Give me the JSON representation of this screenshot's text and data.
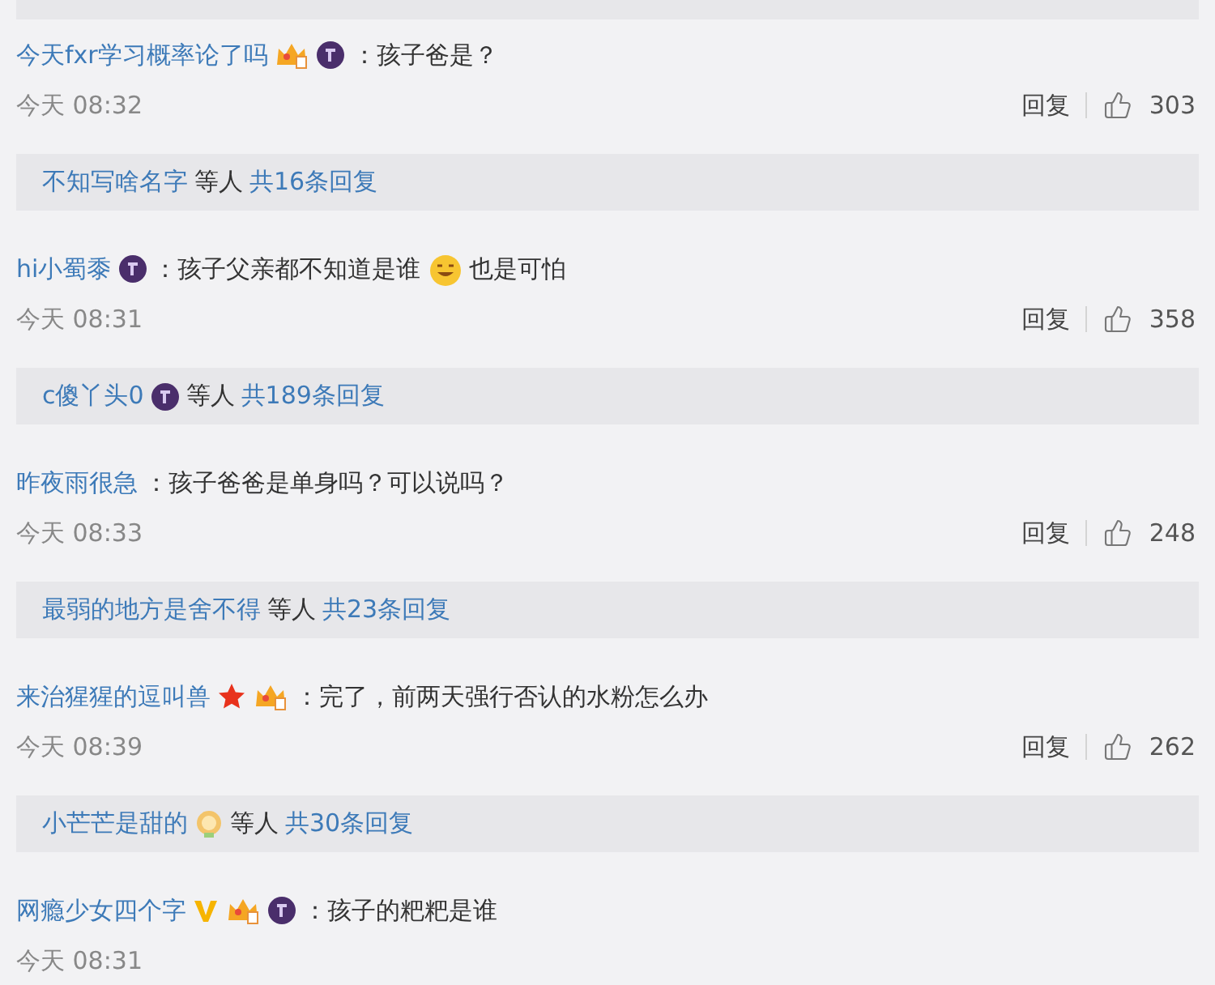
{
  "comments": [
    {
      "user": "今天fxr学习概率论了吗",
      "badges": [
        {
          "kind": "crown"
        },
        {
          "kind": "night"
        }
      ],
      "content": [
        {
          "kind": "text",
          "text": "：孩子爸是？"
        }
      ],
      "time": "今天 08:32",
      "actions": {
        "reply": "回复",
        "likes": "303"
      },
      "replies": {
        "user": "不知写啥名字",
        "others": "等人",
        "count": "共16条回复"
      }
    },
    {
      "user": "hi小蜀黍",
      "badges": [
        {
          "kind": "night"
        }
      ],
      "content": [
        {
          "kind": "text",
          "text": "：孩子父亲都不知道是谁"
        },
        {
          "kind": "emoji"
        },
        {
          "kind": "text",
          "text": "也是可怕"
        }
      ],
      "time": "今天 08:31",
      "actions": {
        "reply": "回复",
        "likes": "358"
      },
      "replies": {
        "user": "c傻丫头0",
        "badges": [
          {
            "kind": "night"
          }
        ],
        "others": "等人",
        "count": "共189条回复"
      }
    },
    {
      "user": "昨夜雨很急",
      "content": [
        {
          "kind": "text",
          "text": "：孩子爸爸是单身吗？可以说吗？"
        }
      ],
      "time": "今天 08:33",
      "actions": {
        "reply": "回复",
        "likes": "248"
      },
      "replies": {
        "user": "最弱的地方是舍不得",
        "others": "等人",
        "count": "共23条回复"
      }
    },
    {
      "user": "来治猩猩的逗叫兽",
      "badges": [
        {
          "kind": "star"
        },
        {
          "kind": "crown"
        }
      ],
      "content": [
        {
          "kind": "text",
          "text": "：完了，前两天强行否认的水粉怎么办"
        }
      ],
      "time": "今天 08:39",
      "actions": {
        "reply": "回复",
        "likes": "262"
      },
      "replies": {
        "user": "小芒芒是甜的",
        "badges": [
          {
            "kind": "sun"
          }
        ],
        "others": "等人",
        "count": "共30条回复"
      }
    },
    {
      "user": "网瘾少女四个字",
      "badges": [
        {
          "kind": "v"
        },
        {
          "kind": "crown"
        },
        {
          "kind": "night"
        }
      ],
      "content": [
        {
          "kind": "text",
          "text": "：孩子的粑粑是谁"
        }
      ],
      "time": "今天 08:31"
    }
  ]
}
